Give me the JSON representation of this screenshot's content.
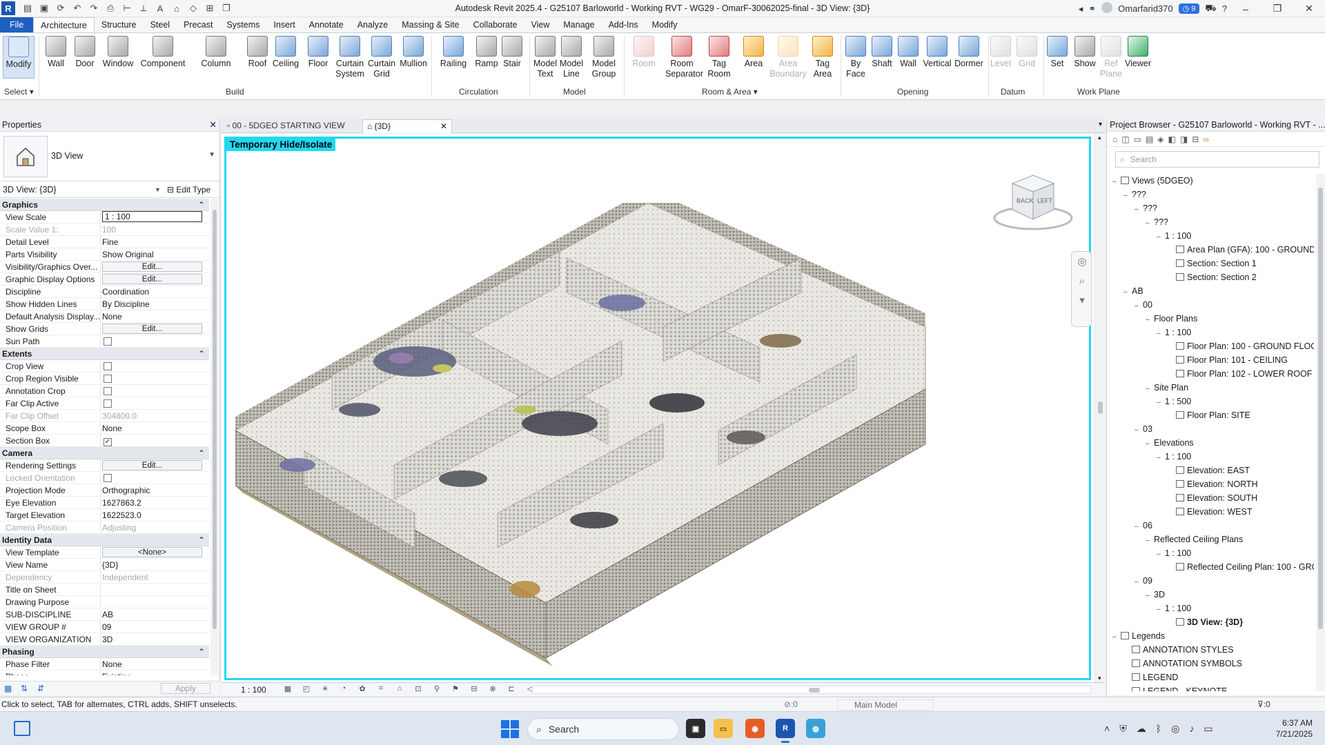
{
  "titlebar": {
    "app_logo": "R",
    "title": "Autodesk Revit 2025.4 - G25107 Barloworld - Working RVT - WG29 - OmarF-30062025-final - 3D View: {3D}",
    "user": "Omarfarid370",
    "notification_count": "9",
    "qat_icons": [
      "open-icon",
      "save-icon",
      "sync-icon",
      "undo-icon",
      "redo-icon",
      "print-icon",
      "measure-icon",
      "align-icon",
      "text-icon",
      "home-icon",
      "3d-icon",
      "section-icon",
      "close-views-icon",
      "switch-windows-icon"
    ]
  },
  "ribbon_tabs": [
    "File",
    "Architecture",
    "Structure",
    "Steel",
    "Precast",
    "Systems",
    "Insert",
    "Annotate",
    "Analyze",
    "Massing & Site",
    "Collaborate",
    "View",
    "Manage",
    "Add-Ins",
    "Modify"
  ],
  "active_tab": "Architecture",
  "ribbon": {
    "select_group": {
      "tool": "Modify",
      "label": "Select"
    },
    "build": {
      "label": "Build",
      "tools": [
        "Wall",
        "Door",
        "Window",
        "Component",
        "Column",
        "Roof",
        "Ceiling",
        "Floor",
        "Curtain System",
        "Curtain Grid",
        "Mullion"
      ]
    },
    "circulation": {
      "label": "Circulation",
      "tools": [
        "Railing",
        "Ramp",
        "Stair"
      ]
    },
    "model": {
      "label": "Model",
      "tools": [
        "Model Text",
        "Model Line",
        "Model Group"
      ]
    },
    "room_area": {
      "label": "Room & Area",
      "tools": [
        "Room",
        "Room Separator",
        "Tag Room",
        "Area",
        "Area Boundary",
        "Tag Area"
      ]
    },
    "opening": {
      "label": "Opening",
      "tools": [
        "By Face",
        "Shaft",
        "Wall",
        "Vertical",
        "Dormer"
      ]
    },
    "datum": {
      "label": "Datum",
      "tools": [
        "Level",
        "Grid"
      ]
    },
    "work_plane": {
      "label": "Work Plane",
      "tools": [
        "Set",
        "Show",
        "Ref Plane",
        "Viewer"
      ]
    }
  },
  "properties": {
    "header": "Properties",
    "type_name": "3D View",
    "instance": "3D View: {3D}",
    "edit_type": "Edit Type",
    "apply": "Apply",
    "sections": [
      {
        "name": "Graphics",
        "rows": [
          {
            "n": "View Scale",
            "v": "1 : 100",
            "kind": "box"
          },
          {
            "n": "Scale Value    1:",
            "v": "100",
            "kind": "text",
            "dim": true
          },
          {
            "n": "Detail Level",
            "v": "Fine",
            "kind": "text"
          },
          {
            "n": "Parts Visibility",
            "v": "Show Original",
            "kind": "text"
          },
          {
            "n": "Visibility/Graphics Over...",
            "v": "Edit...",
            "kind": "btn"
          },
          {
            "n": "Graphic Display Options",
            "v": "Edit...",
            "kind": "btn"
          },
          {
            "n": "Discipline",
            "v": "Coordination",
            "kind": "text"
          },
          {
            "n": "Show Hidden Lines",
            "v": "By Discipline",
            "kind": "text"
          },
          {
            "n": "Default Analysis Display...",
            "v": "None",
            "kind": "text"
          },
          {
            "n": "Show Grids",
            "v": "Edit...",
            "kind": "btn"
          },
          {
            "n": "Sun Path",
            "v": "",
            "kind": "chk",
            "checked": false
          }
        ]
      },
      {
        "name": "Extents",
        "rows": [
          {
            "n": "Crop View",
            "v": "",
            "kind": "chk",
            "checked": false
          },
          {
            "n": "Crop Region Visible",
            "v": "",
            "kind": "chk",
            "checked": false
          },
          {
            "n": "Annotation Crop",
            "v": "",
            "kind": "chk",
            "checked": false
          },
          {
            "n": "Far Clip Active",
            "v": "",
            "kind": "chk",
            "checked": false
          },
          {
            "n": "Far Clip Offset",
            "v": "304800.0",
            "kind": "text",
            "dim": true
          },
          {
            "n": "Scope Box",
            "v": "None",
            "kind": "text"
          },
          {
            "n": "Section Box",
            "v": "",
            "kind": "chk",
            "checked": true
          }
        ]
      },
      {
        "name": "Camera",
        "rows": [
          {
            "n": "Rendering Settings",
            "v": "Edit...",
            "kind": "btn"
          },
          {
            "n": "Locked Orientation",
            "v": "",
            "kind": "chk",
            "checked": false,
            "dim": true
          },
          {
            "n": "Projection Mode",
            "v": "Orthographic",
            "kind": "text"
          },
          {
            "n": "Eye Elevation",
            "v": "1627863.2",
            "kind": "text"
          },
          {
            "n": "Target Elevation",
            "v": "1622523.0",
            "kind": "text"
          },
          {
            "n": "Camera Position",
            "v": "Adjusting",
            "kind": "text",
            "dim": true
          }
        ]
      },
      {
        "name": "Identity Data",
        "rows": [
          {
            "n": "View Template",
            "v": "<None>",
            "kind": "btn"
          },
          {
            "n": "View Name",
            "v": "{3D}",
            "kind": "text"
          },
          {
            "n": "Dependency",
            "v": "Independent",
            "kind": "text",
            "dim": true
          },
          {
            "n": "Title on Sheet",
            "v": "",
            "kind": "text"
          },
          {
            "n": "Drawing Purpose",
            "v": "",
            "kind": "text"
          },
          {
            "n": "SUB-DISCIPLINE",
            "v": "AB",
            "kind": "text"
          },
          {
            "n": "VIEW GROUP #",
            "v": "09",
            "kind": "text"
          },
          {
            "n": "VIEW ORGANIZATION",
            "v": "3D",
            "kind": "text"
          }
        ]
      },
      {
        "name": "Phasing",
        "rows": [
          {
            "n": "Phase Filter",
            "v": "None",
            "kind": "text"
          },
          {
            "n": "Phase",
            "v": "Existing",
            "kind": "text"
          }
        ]
      }
    ]
  },
  "view_tabs": [
    {
      "label": "00 - 5DGEO STARTING VIEW",
      "active": false
    },
    {
      "label": "{3D}",
      "active": true
    }
  ],
  "viewport": {
    "overlay_label": "Temporary Hide/Isolate",
    "viewcube_faces": [
      "BACK",
      "LEFT"
    ],
    "frame_color": "#22d7f2"
  },
  "view_control_bar": {
    "scale": "1 : 100"
  },
  "project_browser": {
    "header": "Project Browser - G25107 Barloworld - Working RVT - ...",
    "search_placeholder": "Search",
    "tree": [
      {
        "d": 0,
        "t": "Views (5DGEO)",
        "type": "folder"
      },
      {
        "d": 1,
        "t": "???",
        "type": "group"
      },
      {
        "d": 2,
        "t": "???",
        "type": "group"
      },
      {
        "d": 3,
        "t": "???",
        "type": "group"
      },
      {
        "d": 4,
        "t": "1 : 100",
        "type": "group"
      },
      {
        "d": 5,
        "t": "Area Plan (GFA): 100 - GROUND",
        "type": "view"
      },
      {
        "d": 5,
        "t": "Section: Section 1",
        "type": "view"
      },
      {
        "d": 5,
        "t": "Section: Section 2",
        "type": "view"
      },
      {
        "d": 1,
        "t": "AB",
        "type": "group"
      },
      {
        "d": 2,
        "t": "00",
        "type": "group"
      },
      {
        "d": 3,
        "t": "Floor Plans",
        "type": "group"
      },
      {
        "d": 4,
        "t": "1 : 100",
        "type": "group"
      },
      {
        "d": 5,
        "t": "Floor Plan: 100 - GROUND FLOO",
        "type": "view"
      },
      {
        "d": 5,
        "t": "Floor Plan: 101 - CEILING",
        "type": "view"
      },
      {
        "d": 5,
        "t": "Floor Plan: 102 - LOWER ROOF",
        "type": "view"
      },
      {
        "d": 3,
        "t": "Site Plan",
        "type": "group"
      },
      {
        "d": 4,
        "t": "1 : 500",
        "type": "group"
      },
      {
        "d": 5,
        "t": "Floor Plan: SITE",
        "type": "view"
      },
      {
        "d": 2,
        "t": "03",
        "type": "group"
      },
      {
        "d": 3,
        "t": "Elevations",
        "type": "group"
      },
      {
        "d": 4,
        "t": "1 : 100",
        "type": "group"
      },
      {
        "d": 5,
        "t": "Elevation: EAST",
        "type": "view"
      },
      {
        "d": 5,
        "t": "Elevation: NORTH",
        "type": "view"
      },
      {
        "d": 5,
        "t": "Elevation: SOUTH",
        "type": "view"
      },
      {
        "d": 5,
        "t": "Elevation: WEST",
        "type": "view"
      },
      {
        "d": 2,
        "t": "06",
        "type": "group"
      },
      {
        "d": 3,
        "t": "Reflected Ceiling Plans",
        "type": "group"
      },
      {
        "d": 4,
        "t": "1 : 100",
        "type": "group"
      },
      {
        "d": 5,
        "t": "Reflected Ceiling Plan: 100 - GRC",
        "type": "view"
      },
      {
        "d": 2,
        "t": "09",
        "type": "group"
      },
      {
        "d": 3,
        "t": "3D",
        "type": "group"
      },
      {
        "d": 4,
        "t": "1 : 100",
        "type": "group"
      },
      {
        "d": 5,
        "t": "3D View: {3D}",
        "type": "view",
        "bold": true
      },
      {
        "d": 0,
        "t": "Legends",
        "type": "folder"
      },
      {
        "d": 1,
        "t": "ANNOTATION STYLES",
        "type": "view"
      },
      {
        "d": 1,
        "t": "ANNOTATION SYMBOLS",
        "type": "view"
      },
      {
        "d": 1,
        "t": "LEGEND",
        "type": "view"
      },
      {
        "d": 1,
        "t": "LEGEND - KEYNOTE",
        "type": "view"
      }
    ]
  },
  "statusbar": {
    "message": "Click to select, TAB for alternates, CTRL adds, SHIFT unselects.",
    "selection_count": ":0",
    "model": "Main Model",
    "filter_count": ":0"
  },
  "taskbar": {
    "search_label": "Search",
    "apps": [
      "File Explorer",
      "Firefox",
      "Revit",
      "Web App"
    ],
    "time": "6:37 AM",
    "date": "7/21/2025"
  }
}
